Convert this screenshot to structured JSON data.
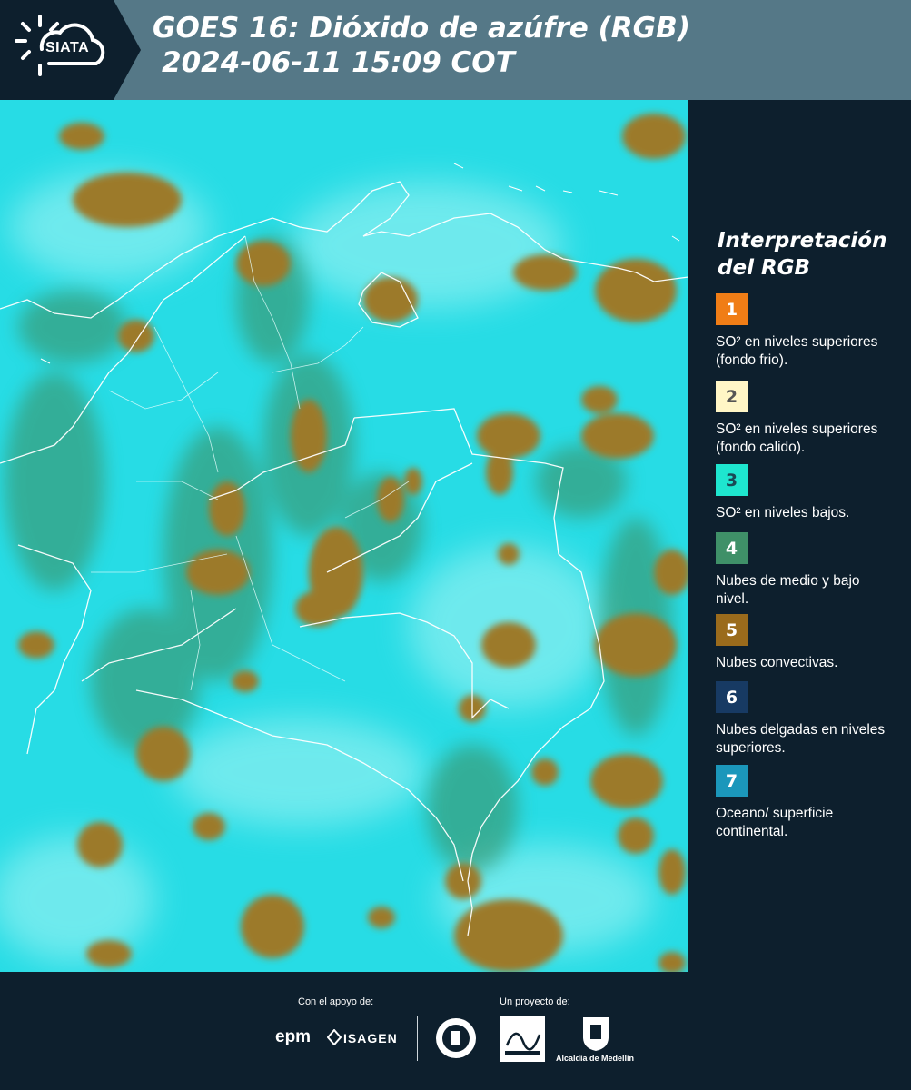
{
  "header": {
    "logo_text": "SIATA",
    "title_line1": "GOES 16: Dióxido de azúfre (RGB)",
    "title_line2": "2024-06-11 15:09 COT"
  },
  "legend": {
    "title_line1": "Interpretación",
    "title_line2": "del RGB",
    "items": [
      {
        "number": "1",
        "color": "#f07d16",
        "text_color": "#ffffff",
        "label": "SO² en niveles superiores (fondo frio)."
      },
      {
        "number": "2",
        "color": "#fff6c6",
        "text_color": "#555555",
        "label": "SO² en niveles superiores (fondo calido)."
      },
      {
        "number": "3",
        "color": "#1ee6cf",
        "text_color": "#1a4a55",
        "label": "SO² en niveles bajos."
      },
      {
        "number": "4",
        "color": "#3f9068",
        "text_color": "#ffffff",
        "label": "Nubes de medio y bajo nivel."
      },
      {
        "number": "5",
        "color": "#9a6b1c",
        "text_color": "#ffffff",
        "label": "Nubes convectivas."
      },
      {
        "number": "6",
        "color": "#173a63",
        "text_color": "#ffffff",
        "label": "Nubes delgadas en niveles superiores."
      },
      {
        "number": "7",
        "color": "#1b97bb",
        "text_color": "#ffffff",
        "label": "Oceano/ superficie continental."
      }
    ]
  },
  "footer": {
    "support_label": "Con el apoyo de:",
    "project_label": "Un proyecto de:",
    "epm": "epm",
    "isagen": "ISAGEN",
    "alcaldia": "Alcaldía de Medellín"
  },
  "map_colors": {
    "background": "#27dce5",
    "convective_cloud": "#9c7a2c",
    "mid_low_cloud": "#3c8a5a",
    "boundaries": "#ffffff"
  }
}
